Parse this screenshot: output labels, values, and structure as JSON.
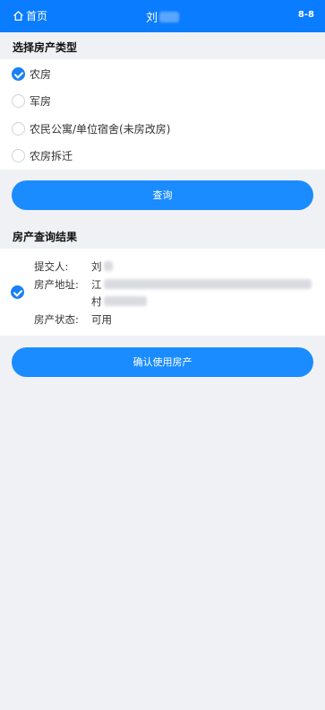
{
  "header": {
    "home_label": "首页",
    "title": "刘",
    "version": "8-8",
    "accent": "#0a7cff"
  },
  "property_type": {
    "section_title": "选择房产类型",
    "options": [
      {
        "label": "农房",
        "checked": true
      },
      {
        "label": "军房",
        "checked": false
      },
      {
        "label": "农民公寓/单位宿舍(未房改房)",
        "checked": false
      },
      {
        "label": "农房拆迁",
        "checked": false
      }
    ]
  },
  "query_button": {
    "label": "查询"
  },
  "results": {
    "section_title": "房产查询结果",
    "submitter_label": "提交人:",
    "submitter_value": "刘",
    "address_label": "房产地址:",
    "address_line1": "江",
    "address_line2": "村",
    "status_label": "房产状态:",
    "status_value": "可用"
  },
  "confirm_button": {
    "label": "确认使用房产"
  }
}
